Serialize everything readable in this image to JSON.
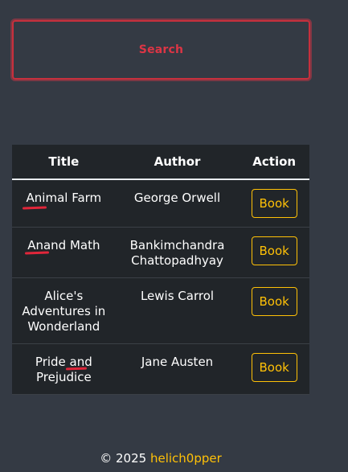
{
  "search": {
    "placeholder": "Search"
  },
  "table": {
    "headers": [
      "Title",
      "Author",
      "Action"
    ],
    "rows": [
      {
        "title": "Animal Farm",
        "author": "George Orwell",
        "action": "Book"
      },
      {
        "title": "Anand Math",
        "author": "Bankimchandra Chattopadhyay",
        "action": "Book"
      },
      {
        "title": "Alice's Adventures in Wonderland",
        "author": "Lewis Carrol",
        "action": "Book"
      },
      {
        "title": "Pride and Prejudice",
        "author": "Jane Austen",
        "action": "Book"
      }
    ]
  },
  "footer": {
    "copyright": "© 2025",
    "author_link": "helich0pper"
  },
  "colors": {
    "background": "#343a44",
    "table_background": "#212529",
    "search_accent": "#dc3545",
    "button_accent": "#ffc107",
    "annotation_mark": "#e0263a"
  }
}
